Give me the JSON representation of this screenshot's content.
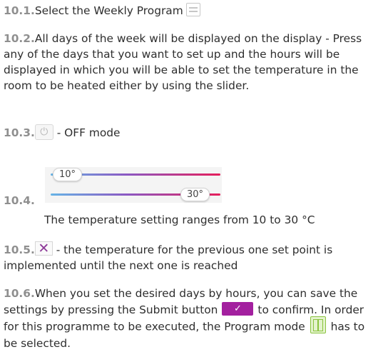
{
  "items": [
    {
      "num": "10.1.",
      "text": "Select the Weekly Program",
      "icon": "weekly-program-icon"
    },
    {
      "num": "10.2.",
      "text": "All days of the week will be displayed on the display - Press any of the days that you want to set up and the hours will be displayed in which you will be able to set the temperature in the room to be heated either by using the slider."
    },
    {
      "num": "10.3.",
      "text": " - OFF mode",
      "icon": "power-icon",
      "icon_glyph": "⏻"
    },
    {
      "num": "10.4.",
      "text": "The temperature setting ranges from 10 to 30 °C",
      "slider": {
        "min_label": "10°",
        "max_label": "30°",
        "min": 10,
        "max": 30
      }
    },
    {
      "num": "10.5.",
      "text": " - the temperature for the previous one set point is implemented until the next one is reached",
      "icon": "close-x-icon",
      "icon_glyph": "✕"
    },
    {
      "num": "10.6.",
      "text_before": "When you set the desired days by hours, you can save the settings by pressing the Submit button",
      "submit_glyph": "✓",
      "text_middle": "to confirm. In order for this programme to be executed, the Program mode",
      "text_after": "has to be selected."
    }
  ],
  "colors": {
    "number": "#8f8f8f",
    "accent": "#a3209f",
    "program_green": "#8ac33f",
    "slider_start": "#66b4e6",
    "slider_end": "#e51e5b"
  }
}
